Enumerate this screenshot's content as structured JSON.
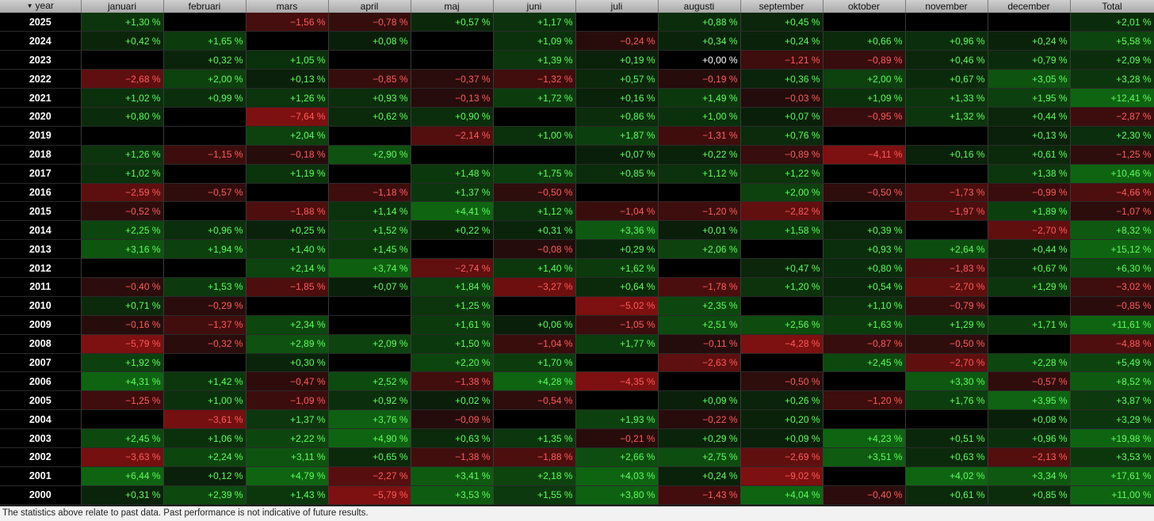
{
  "header": {
    "year_label": "year",
    "months": [
      "januari",
      "februari",
      "mars",
      "april",
      "maj",
      "juni",
      "juli",
      "augusti",
      "september",
      "oktober",
      "november",
      "december",
      "Total"
    ]
  },
  "colors": {
    "positive_text": "#5aff5a",
    "negative_text": "#ff5a5a",
    "positive_bg": "#0f5a12",
    "negative_bg": "#6a0e0e"
  },
  "rows": [
    {
      "year": "2025",
      "values": [
        "+1,30 %",
        "",
        "−1,56 %",
        "−0,78 %",
        "+0,57 %",
        "+1,17 %",
        "",
        "+0,88 %",
        "+0,45 %",
        "",
        "",
        "",
        "+2,01 %"
      ]
    },
    {
      "year": "2024",
      "values": [
        "+0,42 %",
        "+1,65 %",
        "",
        "+0,08 %",
        "",
        "+1,09 %",
        "−0,24 %",
        "+0,34 %",
        "+0,24 %",
        "+0,66 %",
        "+0,96 %",
        "+0,24 %",
        "+5,58 %"
      ]
    },
    {
      "year": "2023",
      "values": [
        "",
        "+0,32 %",
        "+1,05 %",
        "",
        "",
        "+1,39 %",
        "+0,19 %",
        "+0,00 %",
        "−1,21 %",
        "−0,89 %",
        "+0,46 %",
        "+0,79 %",
        "+2,09 %"
      ]
    },
    {
      "year": "2022",
      "values": [
        "−2,68 %",
        "+2,00 %",
        "+0,13 %",
        "−0,85 %",
        "−0,37 %",
        "−1,32 %",
        "+0,57 %",
        "−0,19 %",
        "+0,36 %",
        "+2,00 %",
        "+0,67 %",
        "+3,05 %",
        "+3,28 %"
      ]
    },
    {
      "year": "2021",
      "values": [
        "+1,02 %",
        "+0,99 %",
        "+1,26 %",
        "+0,93 %",
        "−0,13 %",
        "+1,72 %",
        "+0,16 %",
        "+1,49 %",
        "−0,03 %",
        "+1,09 %",
        "+1,33 %",
        "+1,95 %",
        "+12,41 %"
      ]
    },
    {
      "year": "2020",
      "values": [
        "+0,80 %",
        "",
        "−7,64 %",
        "+0,62 %",
        "+0,90 %",
        "",
        "+0,86 %",
        "+1,00 %",
        "+0,07 %",
        "−0,95 %",
        "+1,32 %",
        "+0,44 %",
        "−2,87 %"
      ]
    },
    {
      "year": "2019",
      "values": [
        "",
        "",
        "+2,04 %",
        "",
        "−2,14 %",
        "+1,00 %",
        "+1,87 %",
        "−1,31 %",
        "+0,76 %",
        "",
        "",
        "+0,13 %",
        "+2,30 %"
      ]
    },
    {
      "year": "2018",
      "values": [
        "+1,26 %",
        "−1,15 %",
        "−0,18 %",
        "+2,90 %",
        "",
        "",
        "+0,07 %",
        "+0,22 %",
        "−0,89 %",
        "−4,11 %",
        "+0,16 %",
        "+0,61 %",
        "−1,25 %"
      ]
    },
    {
      "year": "2017",
      "values": [
        "+1,02 %",
        "",
        "+1,19 %",
        "",
        "+1,48 %",
        "+1,75 %",
        "+0,85 %",
        "+1,12 %",
        "+1,22 %",
        "",
        "",
        "+1,38 %",
        "+10,46 %"
      ]
    },
    {
      "year": "2016",
      "values": [
        "−2,59 %",
        "−0,57 %",
        "",
        "−1,18 %",
        "+1,37 %",
        "−0,50 %",
        "",
        "",
        "+2,00 %",
        "−0,50 %",
        "−1,73 %",
        "−0,99 %",
        "−4,66 %"
      ]
    },
    {
      "year": "2015",
      "values": [
        "−0,52 %",
        "",
        "−1,88 %",
        "+1,14 %",
        "+4,41 %",
        "+1,12 %",
        "−1,04 %",
        "−1,20 %",
        "−2,82 %",
        "",
        "−1,97 %",
        "+1,89 %",
        "−1,07 %"
      ]
    },
    {
      "year": "2014",
      "values": [
        "+2,25 %",
        "+0,96 %",
        "+0,25 %",
        "+1,52 %",
        "+0,22 %",
        "+0,31 %",
        "+3,36 %",
        "+0,01 %",
        "+1,58 %",
        "+0,39 %",
        "",
        "−2,70 %",
        "+8,32 %"
      ]
    },
    {
      "year": "2013",
      "values": [
        "+3,16 %",
        "+1,94 %",
        "+1,40 %",
        "+1,45 %",
        "",
        "−0,08 %",
        "+0,29 %",
        "+2,06 %",
        "",
        "+0,93 %",
        "+2,64 %",
        "+0,44 %",
        "+15,12 %"
      ]
    },
    {
      "year": "2012",
      "values": [
        "",
        "",
        "+2,14 %",
        "+3,74 %",
        "−2,74 %",
        "+1,40 %",
        "+1,62 %",
        "",
        "+0,47 %",
        "+0,80 %",
        "−1,83 %",
        "+0,67 %",
        "+6,30 %"
      ]
    },
    {
      "year": "2011",
      "values": [
        "−0,40 %",
        "+1,53 %",
        "−1,85 %",
        "+0,07 %",
        "+1,84 %",
        "−3,27 %",
        "+0,64 %",
        "−1,78 %",
        "+1,20 %",
        "+0,54 %",
        "−2,70 %",
        "+1,29 %",
        "−3,02 %"
      ]
    },
    {
      "year": "2010",
      "values": [
        "+0,71 %",
        "−0,29 %",
        "",
        "",
        "+1,25 %",
        "",
        "−5,02 %",
        "+2,35 %",
        "",
        "+1,10 %",
        "−0,79 %",
        "",
        "−0,85 %"
      ]
    },
    {
      "year": "2009",
      "values": [
        "−0,16 %",
        "−1,37 %",
        "+2,34 %",
        "",
        "+1,61 %",
        "+0,06 %",
        "−1,05 %",
        "+2,51 %",
        "+2,56 %",
        "+1,63 %",
        "+1,29 %",
        "+1,71 %",
        "+11,61 %"
      ]
    },
    {
      "year": "2008",
      "values": [
        "−5,79 %",
        "−0,32 %",
        "+2,89 %",
        "+2,09 %",
        "+1,50 %",
        "−1,04 %",
        "+1,77 %",
        "−0,11 %",
        "−4,28 %",
        "−0,87 %",
        "−0,50 %",
        "",
        "−4,88 %"
      ]
    },
    {
      "year": "2007",
      "values": [
        "+1,92 %",
        "",
        "+0,30 %",
        "",
        "+2,20 %",
        "+1,70 %",
        "",
        "−2,63 %",
        "",
        "+2,45 %",
        "−2,70 %",
        "+2,28 %",
        "+5,49 %"
      ]
    },
    {
      "year": "2006",
      "values": [
        "+4,31 %",
        "+1,42 %",
        "−0,47 %",
        "+2,52 %",
        "−1,38 %",
        "+4,28 %",
        "−4,35 %",
        "",
        "−0,50 %",
        "",
        "+3,30 %",
        "−0,57 %",
        "+8,52 %"
      ]
    },
    {
      "year": "2005",
      "values": [
        "−1,25 %",
        "+1,00 %",
        "−1,09 %",
        "+0,92 %",
        "+0,02 %",
        "−0,54 %",
        "",
        "+0,09 %",
        "+0,26 %",
        "−1,20 %",
        "+1,76 %",
        "+3,95 %",
        "+3,87 %"
      ]
    },
    {
      "year": "2004",
      "values": [
        "",
        "−3,61 %",
        "+1,37 %",
        "+3,76 %",
        "−0,09 %",
        "",
        "+1,93 %",
        "−0,22 %",
        "+0,20 %",
        "",
        "",
        "+0,08 %",
        "+3,29 %"
      ]
    },
    {
      "year": "2003",
      "values": [
        "+2,45 %",
        "+1,06 %",
        "+2,22 %",
        "+4,90 %",
        "+0,63 %",
        "+1,35 %",
        "−0,21 %",
        "+0,29 %",
        "+0,09 %",
        "+4,23 %",
        "+0,51 %",
        "+0,96 %",
        "+19,98 %"
      ]
    },
    {
      "year": "2002",
      "values": [
        "−3,63 %",
        "+2,24 %",
        "+3,11 %",
        "+0,65 %",
        "−1,38 %",
        "−1,88 %",
        "+2,66 %",
        "+2,75 %",
        "−2,69 %",
        "+3,51 %",
        "+0,63 %",
        "−2,13 %",
        "+3,53 %"
      ]
    },
    {
      "year": "2001",
      "values": [
        "+6,44 %",
        "+0,12 %",
        "+4,79 %",
        "−2,27 %",
        "+3,41 %",
        "+2,18 %",
        "+4,03 %",
        "+0,24 %",
        "−9,02 %",
        "",
        "+4,02 %",
        "+3,34 %",
        "+17,61 %"
      ]
    },
    {
      "year": "2000",
      "values": [
        "+0,31 %",
        "+2,39 %",
        "+1,43 %",
        "−5,79 %",
        "+3,53 %",
        "+1,55 %",
        "+3,80 %",
        "−1,43 %",
        "+4,04 %",
        "−0,40 %",
        "+0,61 %",
        "+0,85 %",
        "+11,00 %"
      ]
    }
  ],
  "footer": {
    "disclaimer": "The statistics above relate to past data. Past performance is not indicative of future results."
  }
}
